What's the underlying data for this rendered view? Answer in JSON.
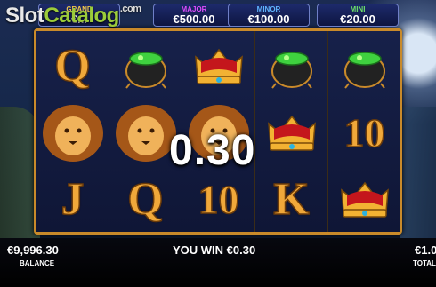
{
  "watermark": {
    "part1": "Slot",
    "part2": "Catalog",
    "suffix": ".com"
  },
  "jackpots": {
    "grand": {
      "label": "GRAND",
      "value": "€..."
    },
    "major": {
      "label": "MAJOR",
      "value": "€500.00"
    },
    "minor": {
      "label": "MINOR",
      "value": "€100.00"
    },
    "mini": {
      "label": "MINI",
      "value": "€20.00"
    }
  },
  "reels": [
    [
      "Q",
      "lion",
      "J"
    ],
    [
      "pot",
      "lion",
      "Q"
    ],
    [
      "crown",
      "lion",
      "10"
    ],
    [
      "pot",
      "crown",
      "K"
    ],
    [
      "pot",
      "10",
      "crown"
    ]
  ],
  "win_overlay": "0.30",
  "footer": {
    "balance_value": "€9,996.30",
    "balance_label": "BALANCE",
    "win_message": "YOU WIN €0.30",
    "total_bet_value": "€1.0",
    "total_bet_label": "TOTAL"
  },
  "colors": {
    "frame": "#c98a2a",
    "gold_symbol": "#f0a83a",
    "grand": "#f2c94c",
    "major": "#e04cff",
    "minor": "#5fb4ff",
    "mini": "#6de36a"
  }
}
